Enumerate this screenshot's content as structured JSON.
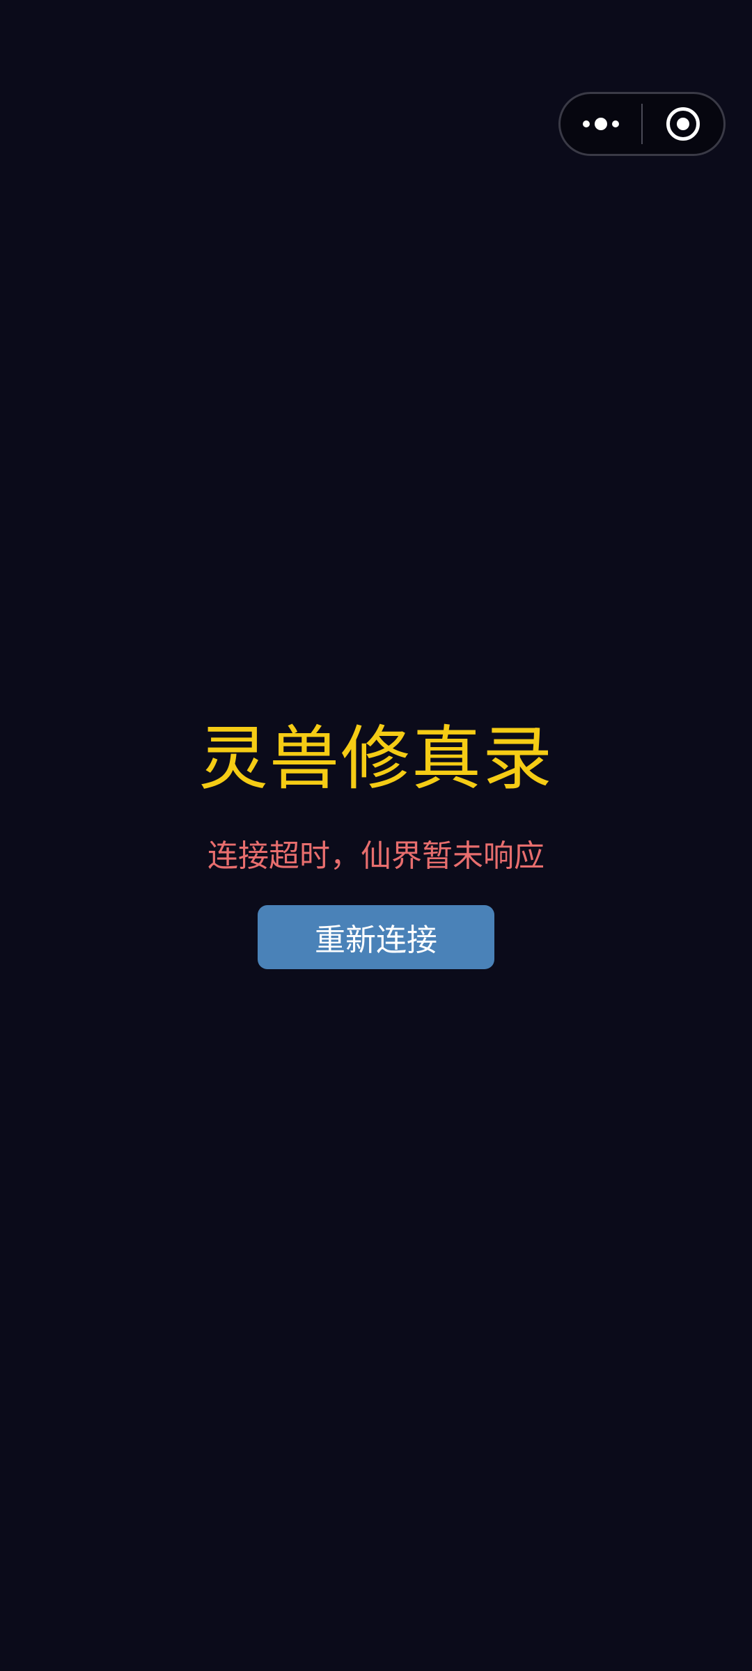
{
  "capsule": {
    "more_icon": "more-dots-icon",
    "close_icon": "target-circle-icon"
  },
  "main": {
    "title": "灵兽修真录",
    "error_message": "连接超时，仙界暂未响应",
    "retry_label": "重新连接"
  },
  "colors": {
    "background": "#0b0b1a",
    "title": "#f5cc15",
    "error": "#e86e6e",
    "button": "#4a82b8"
  }
}
